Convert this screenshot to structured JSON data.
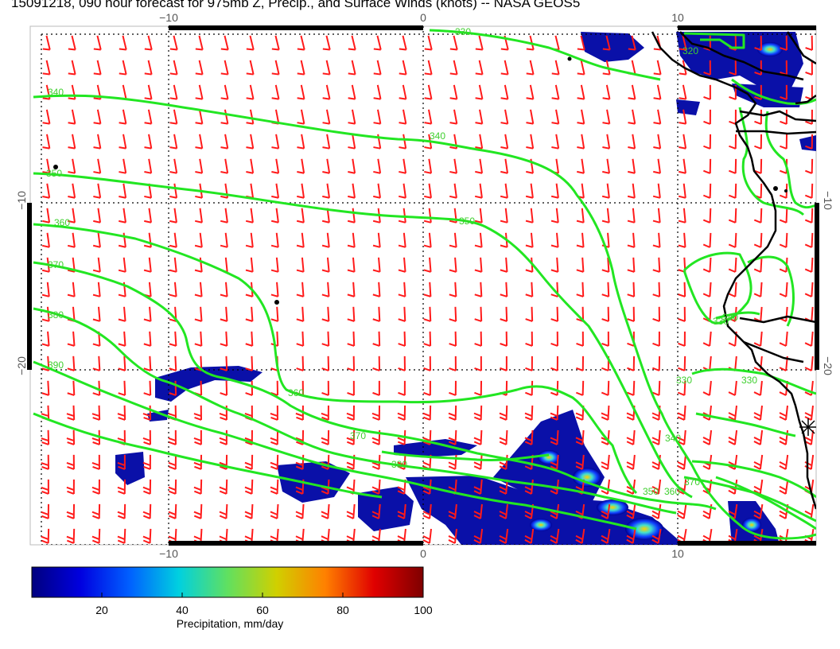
{
  "title": "15091218, 090 hour forecast for 975mb Z, Precip., and Surface Winds (knots) -- NASA GEOS5",
  "map": {
    "top_ticks": [
      "−10",
      "0",
      "10"
    ],
    "bottom_ticks": [
      "−10",
      "0",
      "10"
    ],
    "left_ticks": [
      "−10",
      "−20"
    ],
    "right_ticks": [
      "−10",
      "−20"
    ],
    "contour_color": "#22e622",
    "barb_color": "#ff1a1a",
    "contour_labels": [
      "340",
      "350",
      "360",
      "370",
      "380",
      "390",
      "340",
      "350",
      "360",
      "370",
      "380",
      "330",
      "320",
      "330",
      "340",
      "350",
      "360",
      "370",
      "330",
      "340",
      "330"
    ]
  },
  "colorbar": {
    "ticks": [
      "20",
      "40",
      "60",
      "80",
      "100"
    ],
    "label": "Precipitation, mm/day",
    "colors": [
      "#00007f",
      "#0000e0",
      "#0060ff",
      "#00d0e0",
      "#60e060",
      "#d0d000",
      "#ff8000",
      "#e00000",
      "#7f0000"
    ]
  }
}
